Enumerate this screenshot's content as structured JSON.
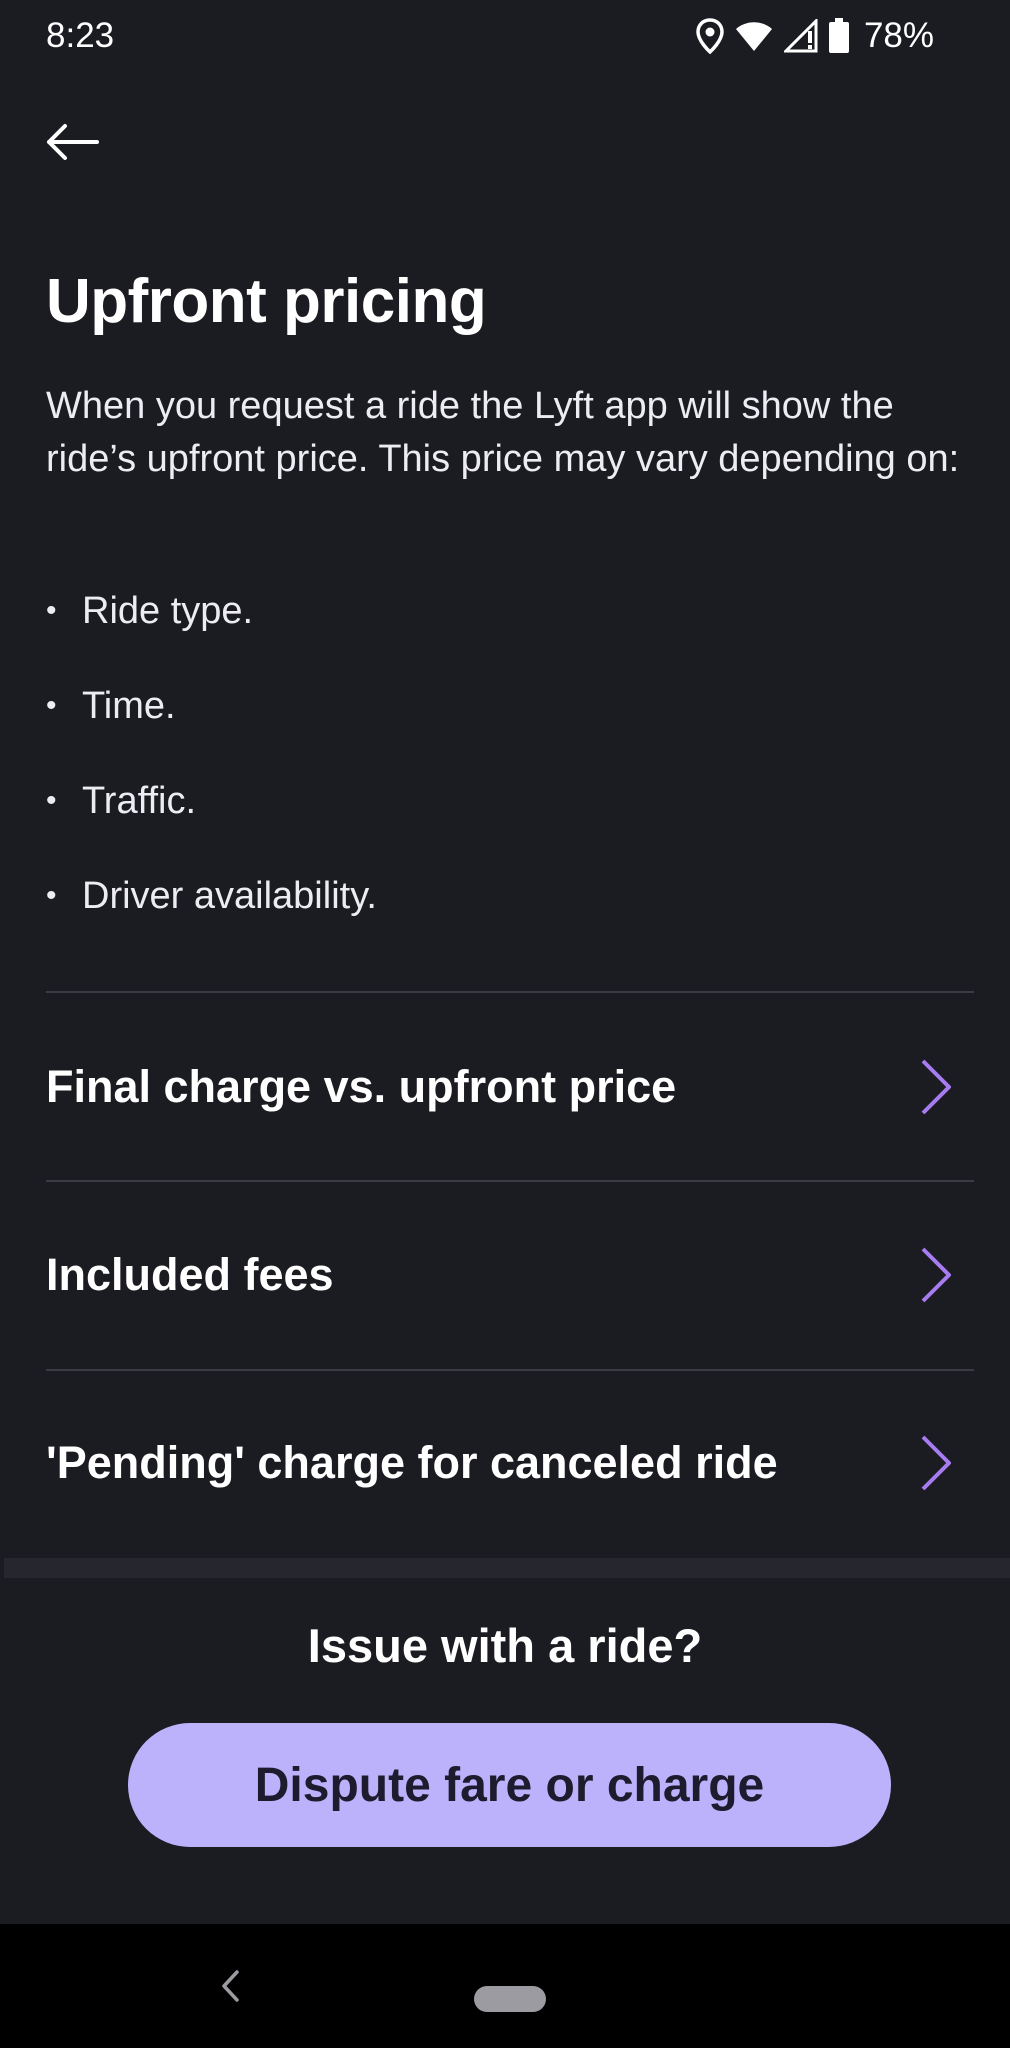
{
  "status_bar": {
    "time": "8:23",
    "battery_percent": "78%",
    "icons": [
      "location-icon",
      "wifi-icon",
      "cell-signal-icon",
      "battery-icon"
    ]
  },
  "header": {
    "back_icon": "arrow-left-icon"
  },
  "article": {
    "title": "Upfront pricing",
    "intro": "When you request a ride the Lyft app will show the ride’s upfront price. This price may vary depending on:",
    "bullets": [
      "Ride type.",
      "Time.",
      "Traffic.",
      "Driver availability."
    ]
  },
  "related_topics": [
    {
      "label": "Final charge vs. upfront price",
      "icon": "chevron-right-icon"
    },
    {
      "label": "Included fees",
      "icon": "chevron-right-icon"
    },
    {
      "label": "'Pending' charge for canceled ride",
      "icon": "chevron-right-icon"
    }
  ],
  "issue_section": {
    "heading": "Issue with a ride?",
    "button_label": "Dispute fare or charge"
  },
  "colors": {
    "background": "#1b1b22",
    "accent": "#bbb2fb",
    "chevron": "#a67cf0",
    "divider": "#3b3b45"
  },
  "nav_bar": {
    "icons": [
      "nav-back-icon",
      "nav-home-pill"
    ]
  }
}
